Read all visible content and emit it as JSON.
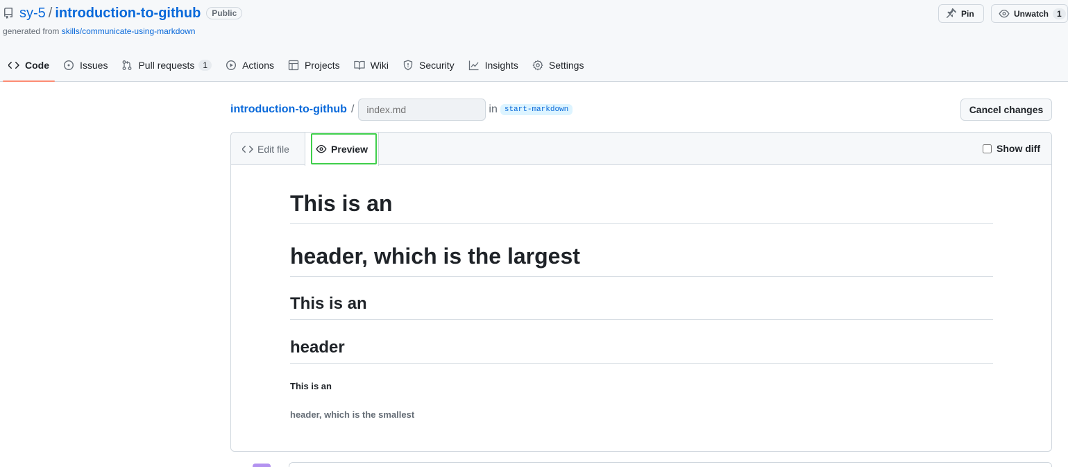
{
  "repo": {
    "owner": "sy-5",
    "name": "introduction-to-github",
    "visibility": "Public",
    "generated_prefix": "generated from",
    "generated_link": "skills/communicate-using-markdown"
  },
  "header_buttons": {
    "pin_label": "Pin",
    "unwatch_label": "Unwatch",
    "watch_count": "1"
  },
  "tabs": [
    {
      "label": "Code",
      "icon": "code-icon"
    },
    {
      "label": "Issues",
      "icon": "issue-icon"
    },
    {
      "label": "Pull requests",
      "icon": "pull-request-icon",
      "count": "1"
    },
    {
      "label": "Actions",
      "icon": "play-icon"
    },
    {
      "label": "Projects",
      "icon": "table-icon"
    },
    {
      "label": "Wiki",
      "icon": "book-icon"
    },
    {
      "label": "Security",
      "icon": "shield-icon"
    },
    {
      "label": "Insights",
      "icon": "graph-icon"
    },
    {
      "label": "Settings",
      "icon": "gear-icon"
    }
  ],
  "breadcrumb": {
    "repo_link": "introduction-to-github",
    "separator": "/",
    "filename_placeholder": "index.md",
    "in_text": "in",
    "branch": "start-markdown"
  },
  "cancel_label": "Cancel changes",
  "editor": {
    "edit_tab": "Edit file",
    "preview_tab": "Preview",
    "show_diff": "Show diff"
  },
  "preview": {
    "h1_a": "This is an",
    "h1_b": "header, which is the largest",
    "h2_a": "This is an",
    "h2_b": "header",
    "h6_a": "This is an",
    "h6_b": "header, which is the smallest"
  },
  "colors": {
    "link": "#0969da",
    "tab_underline": "#fd8c73",
    "preview_highlight": "#3fcf4b"
  }
}
